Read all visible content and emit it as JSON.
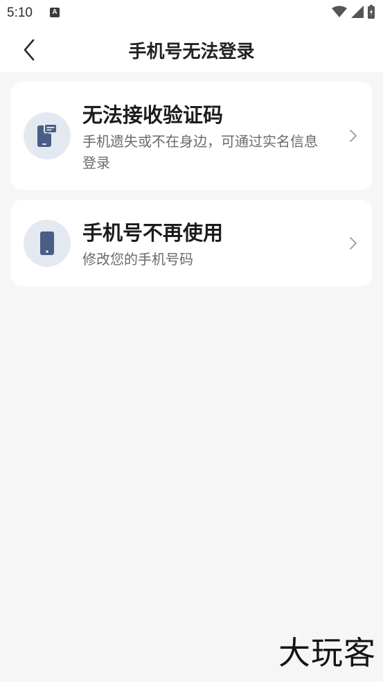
{
  "status_bar": {
    "time": "5:10",
    "notification_icon_letter": "A",
    "icons": [
      "wifi-icon",
      "cell-signal-icon",
      "battery-charging-icon"
    ]
  },
  "header": {
    "title": "手机号无法登录",
    "back_icon": "chevron-left-icon"
  },
  "options": [
    {
      "title": "无法接收验证码",
      "description": "手机遗失或不在身边，可通过实名信息登录",
      "icon": "phone-message-icon"
    },
    {
      "title": "手机号不再使用",
      "description": "修改您的手机号码",
      "icon": "phone-icon"
    }
  ],
  "watermark": "大玩客",
  "colors": {
    "background": "#f6f6f7",
    "card": "#ffffff",
    "icon_circle": "#e4e8f0",
    "icon_accent": "#4a5d86"
  }
}
